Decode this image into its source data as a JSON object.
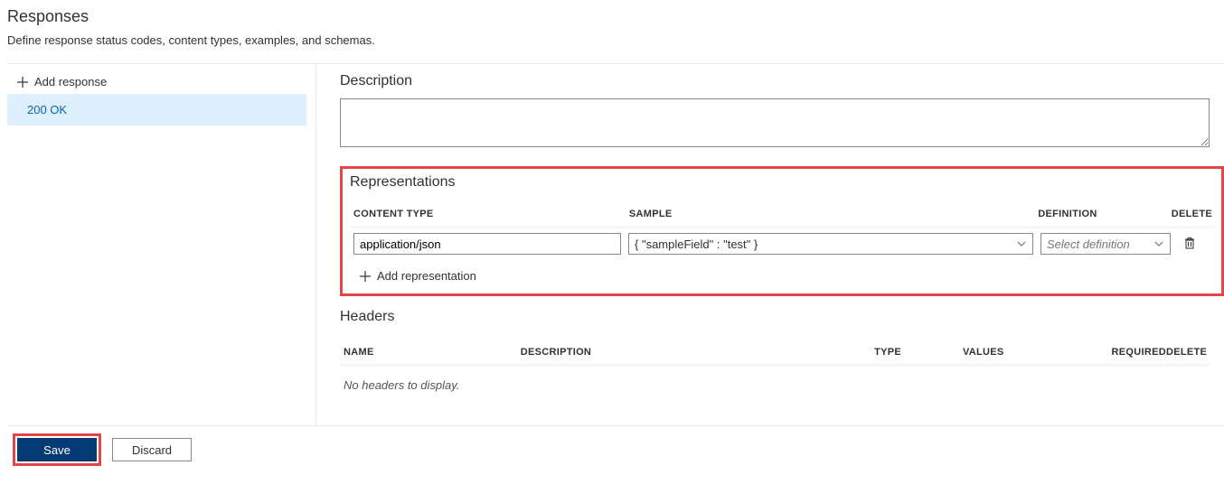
{
  "page_title": "Responses",
  "page_subtitle": "Define response status codes, content types, examples, and schemas.",
  "sidebar": {
    "add_response_label": "Add response",
    "responses": [
      {
        "label": "200 OK",
        "selected": true
      }
    ]
  },
  "description": {
    "title": "Description",
    "value": ""
  },
  "representations": {
    "title": "Representations",
    "columns": {
      "content_type": "CONTENT TYPE",
      "sample": "SAMPLE",
      "definition": "DEFINITION",
      "delete": "DELETE"
    },
    "rows": [
      {
        "content_type": "application/json",
        "sample": "{ \"sampleField\" : \"test\" }",
        "definition_placeholder": "Select definition"
      }
    ],
    "add_label": "Add representation"
  },
  "headers": {
    "title": "Headers",
    "columns": {
      "name": "NAME",
      "description": "DESCRIPTION",
      "type": "TYPE",
      "values": "VALUES",
      "required": "REQUIRED",
      "delete": "DELETE"
    },
    "empty_message": "No headers to display."
  },
  "footer": {
    "save_label": "Save",
    "discard_label": "Discard"
  }
}
